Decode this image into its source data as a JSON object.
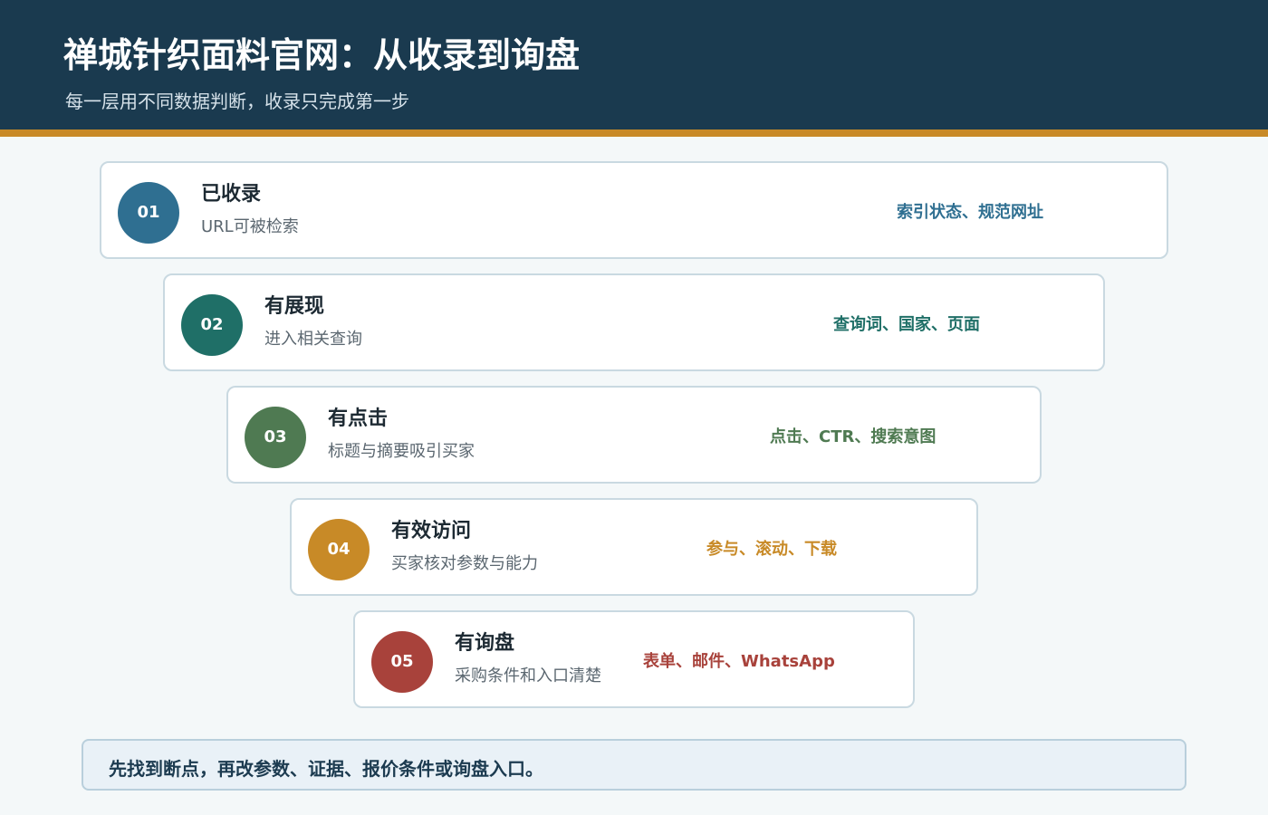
{
  "header": {
    "title": "禅城针织面料官网：从收录到询盘",
    "subtitle": "每一层用不同数据判断，收录只完成第一步"
  },
  "stages": [
    {
      "number": "01",
      "title": "已收录",
      "description": "URL可被检索",
      "metrics": "索引状态、规范网址",
      "color": "#2f6f91"
    },
    {
      "number": "02",
      "title": "有展现",
      "description": "进入相关查询",
      "metrics": "查询词、国家、页面",
      "color": "#1f6f67"
    },
    {
      "number": "03",
      "title": "有点击",
      "description": "标题与摘要吸引买家",
      "metrics": "点击、CTR、搜索意图",
      "color": "#4f7a52"
    },
    {
      "number": "04",
      "title": "有效访问",
      "description": "买家核对参数与能力",
      "metrics": "参与、滚动、下载",
      "color": "#c88a27"
    },
    {
      "number": "05",
      "title": "有询盘",
      "description": "采购条件和入口清楚",
      "metrics": "表单、邮件、WhatsApp",
      "color": "#a8423b"
    }
  ],
  "footer": {
    "note": "先找到断点，再改参数、证据、报价条件或询盘入口。"
  }
}
